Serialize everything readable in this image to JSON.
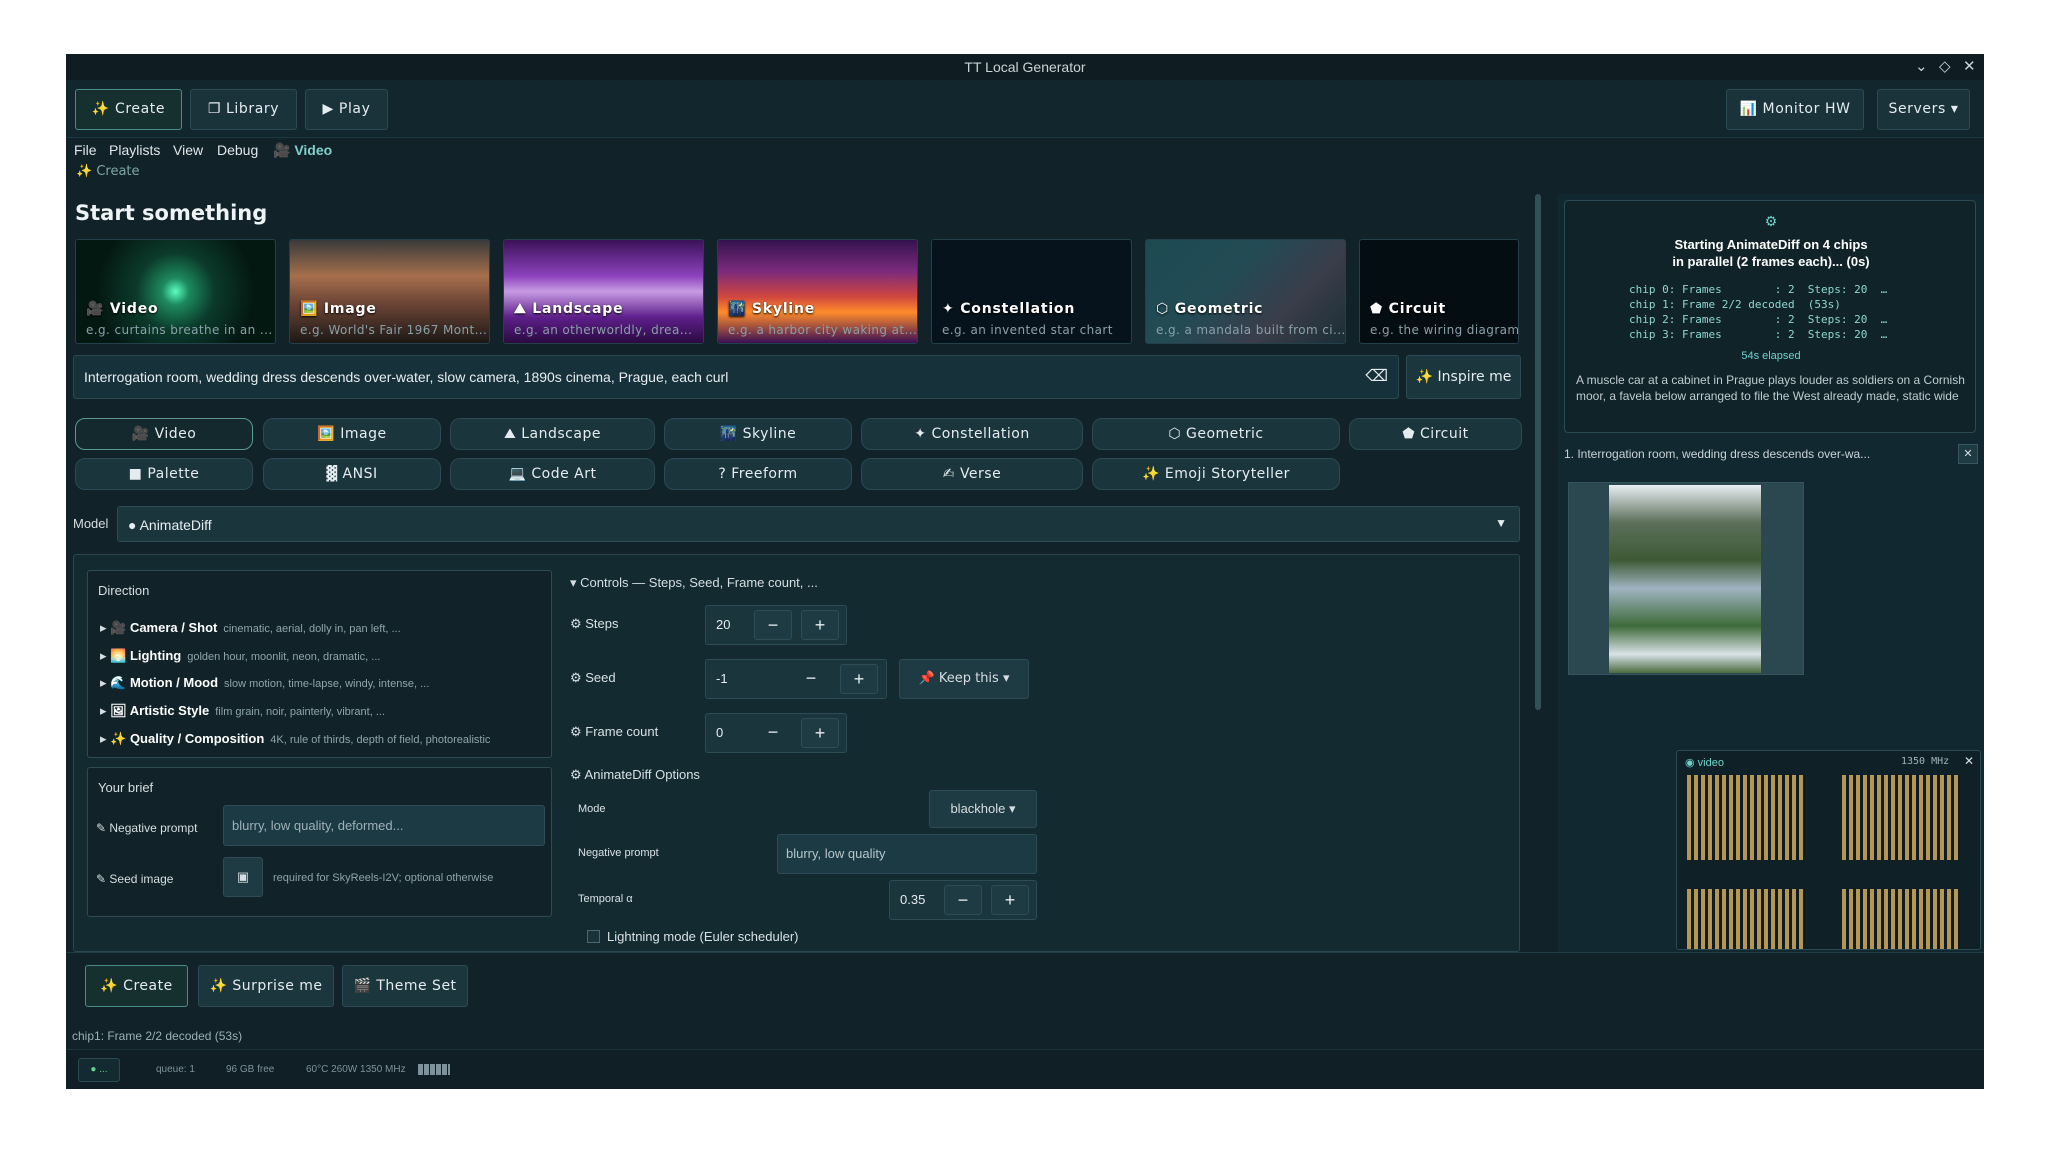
{
  "window": {
    "title": "TT Local Generator"
  },
  "toolbar": {
    "create": "✨ Create",
    "library": "❐ Library",
    "play": "▶ Play",
    "monitor": "📊 Monitor HW",
    "servers": "Servers ▾"
  },
  "menu": {
    "file": "File",
    "playlists": "Playlists",
    "view": "View",
    "debug": "Debug",
    "video": "🎥 Video"
  },
  "breadcrumb": "✨ Create",
  "heading": "Start something",
  "cards": [
    {
      "label": "🎥 Video",
      "hint": "e.g. curtains breathe in an ..."
    },
    {
      "label": "🖼️ Image",
      "hint": "e.g. World's Fair 1967 Mont..."
    },
    {
      "label": "⛰ Landscape",
      "hint": "e.g. an otherworldly, drea..."
    },
    {
      "label": "🌃 Skyline",
      "hint": "e.g. a harbor city waking at..."
    },
    {
      "label": "✦ Constellation",
      "hint": "e.g. an invented star chart"
    },
    {
      "label": "⬡ Geometric",
      "hint": "e.g. a mandala built from ci..."
    },
    {
      "label": "⬟ Circuit",
      "hint": "e.g. the wiring diagram"
    }
  ],
  "prompt": {
    "value": "Interrogation room, wedding dress descends over-water, slow camera, 1890s cinema, Prague, each curl",
    "inspire": "✨ Inspire me"
  },
  "chips_row1": [
    "🎥 Video",
    "🖼️ Image",
    "⛰ Landscape",
    "🌃 Skyline",
    "✦ Constellation",
    "⬡ Geometric",
    "⬟ Circuit"
  ],
  "chips_row2": [
    "■ Palette",
    "▓ ANSI",
    "💻 Code Art",
    "? Freeform",
    "✍ Verse",
    "✨ Emoji Storyteller"
  ],
  "model": {
    "label": "Model",
    "value": "● AnimateDiff"
  },
  "direction": {
    "title": "Direction",
    "rows": [
      {
        "name": "🎥 Camera / Shot",
        "hint": "cinematic, aerial, dolly in, pan left, ..."
      },
      {
        "name": "🌅 Lighting",
        "hint": "golden hour, moonlit, neon, dramatic, ..."
      },
      {
        "name": "🌊 Motion / Mood",
        "hint": "slow motion, time-lapse, windy, intense, ..."
      },
      {
        "name": "🖼 Artistic Style",
        "hint": "film grain, noir, painterly, vibrant, ..."
      },
      {
        "name": "✨ Quality / Composition",
        "hint": "4K, rule of thirds, depth of field, photorealistic"
      }
    ]
  },
  "brief": {
    "title": "Your brief",
    "neg_label": "✎ Negative prompt",
    "neg_placeholder": "blurry, low quality, deformed...",
    "seed_label": "✎ Seed image",
    "seed_hint": "required for SkyReels-I2V; optional otherwise"
  },
  "controls": {
    "header": "▾ Controls — Steps, Seed, Frame count, ...",
    "steps_label": "⚙ Steps",
    "steps": "20",
    "seed_label": "⚙ Seed",
    "seed": "-1",
    "keep": "📌 Keep this ▾",
    "frames_label": "⚙ Frame count",
    "frames": "0",
    "ad_header": "⚙ AnimateDiff Options",
    "mode_label": "Mode",
    "mode": "blackhole ▾",
    "neg_label": "Negative prompt",
    "neg_value": "blurry, low quality",
    "temporal_label": "Temporal α",
    "temporal": "0.35",
    "lightning": "Lightning mode (Euler scheduler)"
  },
  "bottom": {
    "create": "✨ Create",
    "surprise": "✨ Surprise me",
    "theme": "🎬 Theme Set"
  },
  "status_line": "chip1: Frame 2/2 decoded  (53s)",
  "statusbar": {
    "dot": "● ...",
    "queue": "queue: 1",
    "disk": "96 GB free",
    "hw": "60°C  260W  1350 MHz"
  },
  "job": {
    "icon": "⚙",
    "title1": "Starting AnimateDiff on 4 chips",
    "title2": "in parallel (2 frames each)...  (0s)",
    "lines": [
      "chip 0: Frames        : 2  Steps: 20  …",
      "chip 1: Frame 2/2 decoded  (53s)",
      "chip 2: Frames        : 2  Steps: 20  …",
      "chip 3: Frames        : 2  Steps: 20  …"
    ],
    "elapsed": "54s elapsed",
    "desc": "A muscle car at a cabinet in Prague plays louder as soldiers on a Cornish moor, a favela below arranged to file the West already made, static wide"
  },
  "queue_item": "1. Interrogation room, wedding dress descends over-wa...",
  "monitor": {
    "name": "◉ video",
    "mhz": "1350 MHz",
    "close": "✕"
  }
}
